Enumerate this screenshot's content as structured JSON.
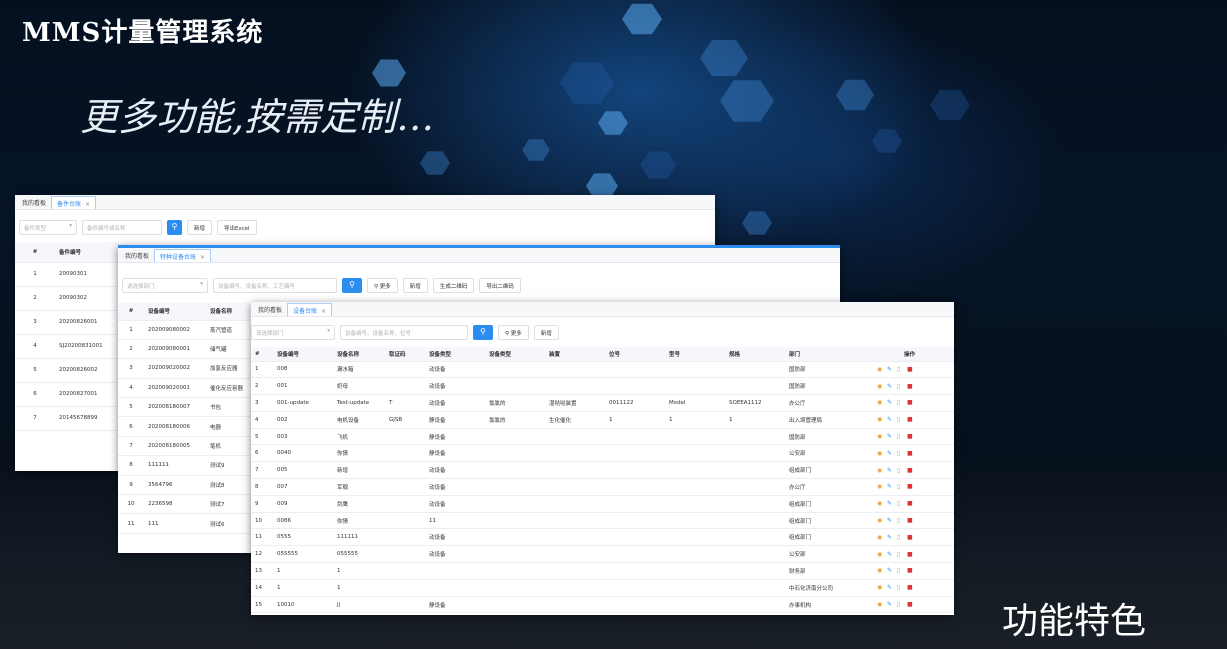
{
  "app_title": "MMS计量管理系统",
  "slogan": "更多功能,按需定制…",
  "feature_label": "功能特色",
  "win1": {
    "tabs": [
      "我的看板",
      "备件台账"
    ],
    "select_placeholder": "备件类型",
    "search_placeholder": "备件编号或名称",
    "buttons": [
      "新增",
      "导出Excel"
    ],
    "columns": [
      "#",
      "备件编号"
    ],
    "rows": [
      [
        "1",
        "20090301"
      ],
      [
        "2",
        "20090302"
      ],
      [
        "3",
        "20200826001"
      ],
      [
        "4",
        "SJ20200831001"
      ],
      [
        "5",
        "20200826002"
      ],
      [
        "6",
        "20200827001"
      ],
      [
        "7",
        "20145678899"
      ]
    ]
  },
  "win2": {
    "tabs": [
      "我的看板",
      "特种设备台账"
    ],
    "select_placeholder": "请选择部门",
    "search_placeholder": "设备编号、设备名称、工艺编号",
    "buttons": [
      "更多",
      "新增",
      "生成二维码",
      "导出二维码"
    ],
    "columns": [
      "#",
      "设备编号",
      "设备名称"
    ],
    "rows": [
      [
        "1",
        "202009080002",
        "蒸汽管道"
      ],
      [
        "2",
        "202009080001",
        "储气罐"
      ],
      [
        "3",
        "202009020002",
        "加氢反应器"
      ],
      [
        "4",
        "202009020001",
        "催化反应容器"
      ],
      [
        "5",
        "202008180007",
        "书包"
      ],
      [
        "6",
        "202008180006",
        "电器"
      ],
      [
        "7",
        "202008180005",
        "笔机"
      ],
      [
        "8",
        "111111",
        "测试9"
      ],
      [
        "9",
        "3564796",
        "测试8"
      ],
      [
        "10",
        "2236598",
        "测试7"
      ],
      [
        "11",
        "111",
        "测试6"
      ]
    ]
  },
  "win3": {
    "tabs": [
      "我的看板",
      "设备台账"
    ],
    "select_placeholder": "请选择部门",
    "search_placeholder": "设备编号、设备名称、位号",
    "buttons": [
      "更多",
      "新增"
    ],
    "columns": [
      "#",
      "设备编号",
      "设备名称",
      "取证码",
      "设备类型",
      "设备类型",
      "装置",
      "位号",
      "型号",
      "规格",
      "部门",
      "操作"
    ],
    "rows": [
      [
        "1",
        "008",
        "漏水箱",
        "",
        "动设备",
        "",
        "",
        "",
        "",
        "",
        "国防部"
      ],
      [
        "2",
        "001",
        "奶母",
        "",
        "动设备",
        "",
        "",
        "",
        "",
        "",
        "国防部"
      ],
      [
        "3",
        "001-update",
        "Test-update",
        "T",
        "动设备",
        "氯氯的",
        "湿哒哒装置",
        "0011122",
        "Model",
        "SOEEA1112",
        "办公厅"
      ],
      [
        "4",
        "002",
        "电机设备",
        "GJSB",
        "静设备",
        "氯氯的",
        "生化催化",
        "1",
        "1",
        "1",
        "出入境管理局"
      ],
      [
        "5",
        "003",
        "飞机",
        "",
        "静设备",
        "",
        "",
        "",
        "",
        "",
        "国防部"
      ],
      [
        "6",
        "0040",
        "你猜",
        "",
        "静设备",
        "",
        "",
        "",
        "",
        "",
        "公安部"
      ],
      [
        "7",
        "005",
        "新增",
        "",
        "动设备",
        "",
        "",
        "",
        "",
        "",
        "组成部门"
      ],
      [
        "8",
        "007",
        "军舰",
        "",
        "动设备",
        "",
        "",
        "",
        "",
        "",
        "办公厅"
      ],
      [
        "9",
        "009",
        "剑鹰",
        "",
        "动设备",
        "",
        "",
        "",
        "",
        "",
        "组成部门"
      ],
      [
        "10",
        "0086",
        "你猜",
        "",
        "11",
        "",
        "",
        "",
        "",
        "",
        "组成部门"
      ],
      [
        "11",
        "0555",
        "111111",
        "",
        "动设备",
        "",
        "",
        "",
        "",
        "",
        "组成部门"
      ],
      [
        "12",
        "055555",
        "055555",
        "",
        "动设备",
        "",
        "",
        "",
        "",
        "",
        "公安部"
      ],
      [
        "13",
        "1",
        "1",
        "",
        "",
        "",
        "",
        "",
        "",
        "",
        "财务部"
      ],
      [
        "14",
        "1",
        "1",
        "",
        "",
        "",
        "",
        "",
        "",
        "",
        "中石化济南分公司"
      ],
      [
        "15",
        "10010",
        "jj",
        "",
        "静设备",
        "",
        "",
        "",
        "",
        "",
        "办事机构"
      ]
    ]
  }
}
